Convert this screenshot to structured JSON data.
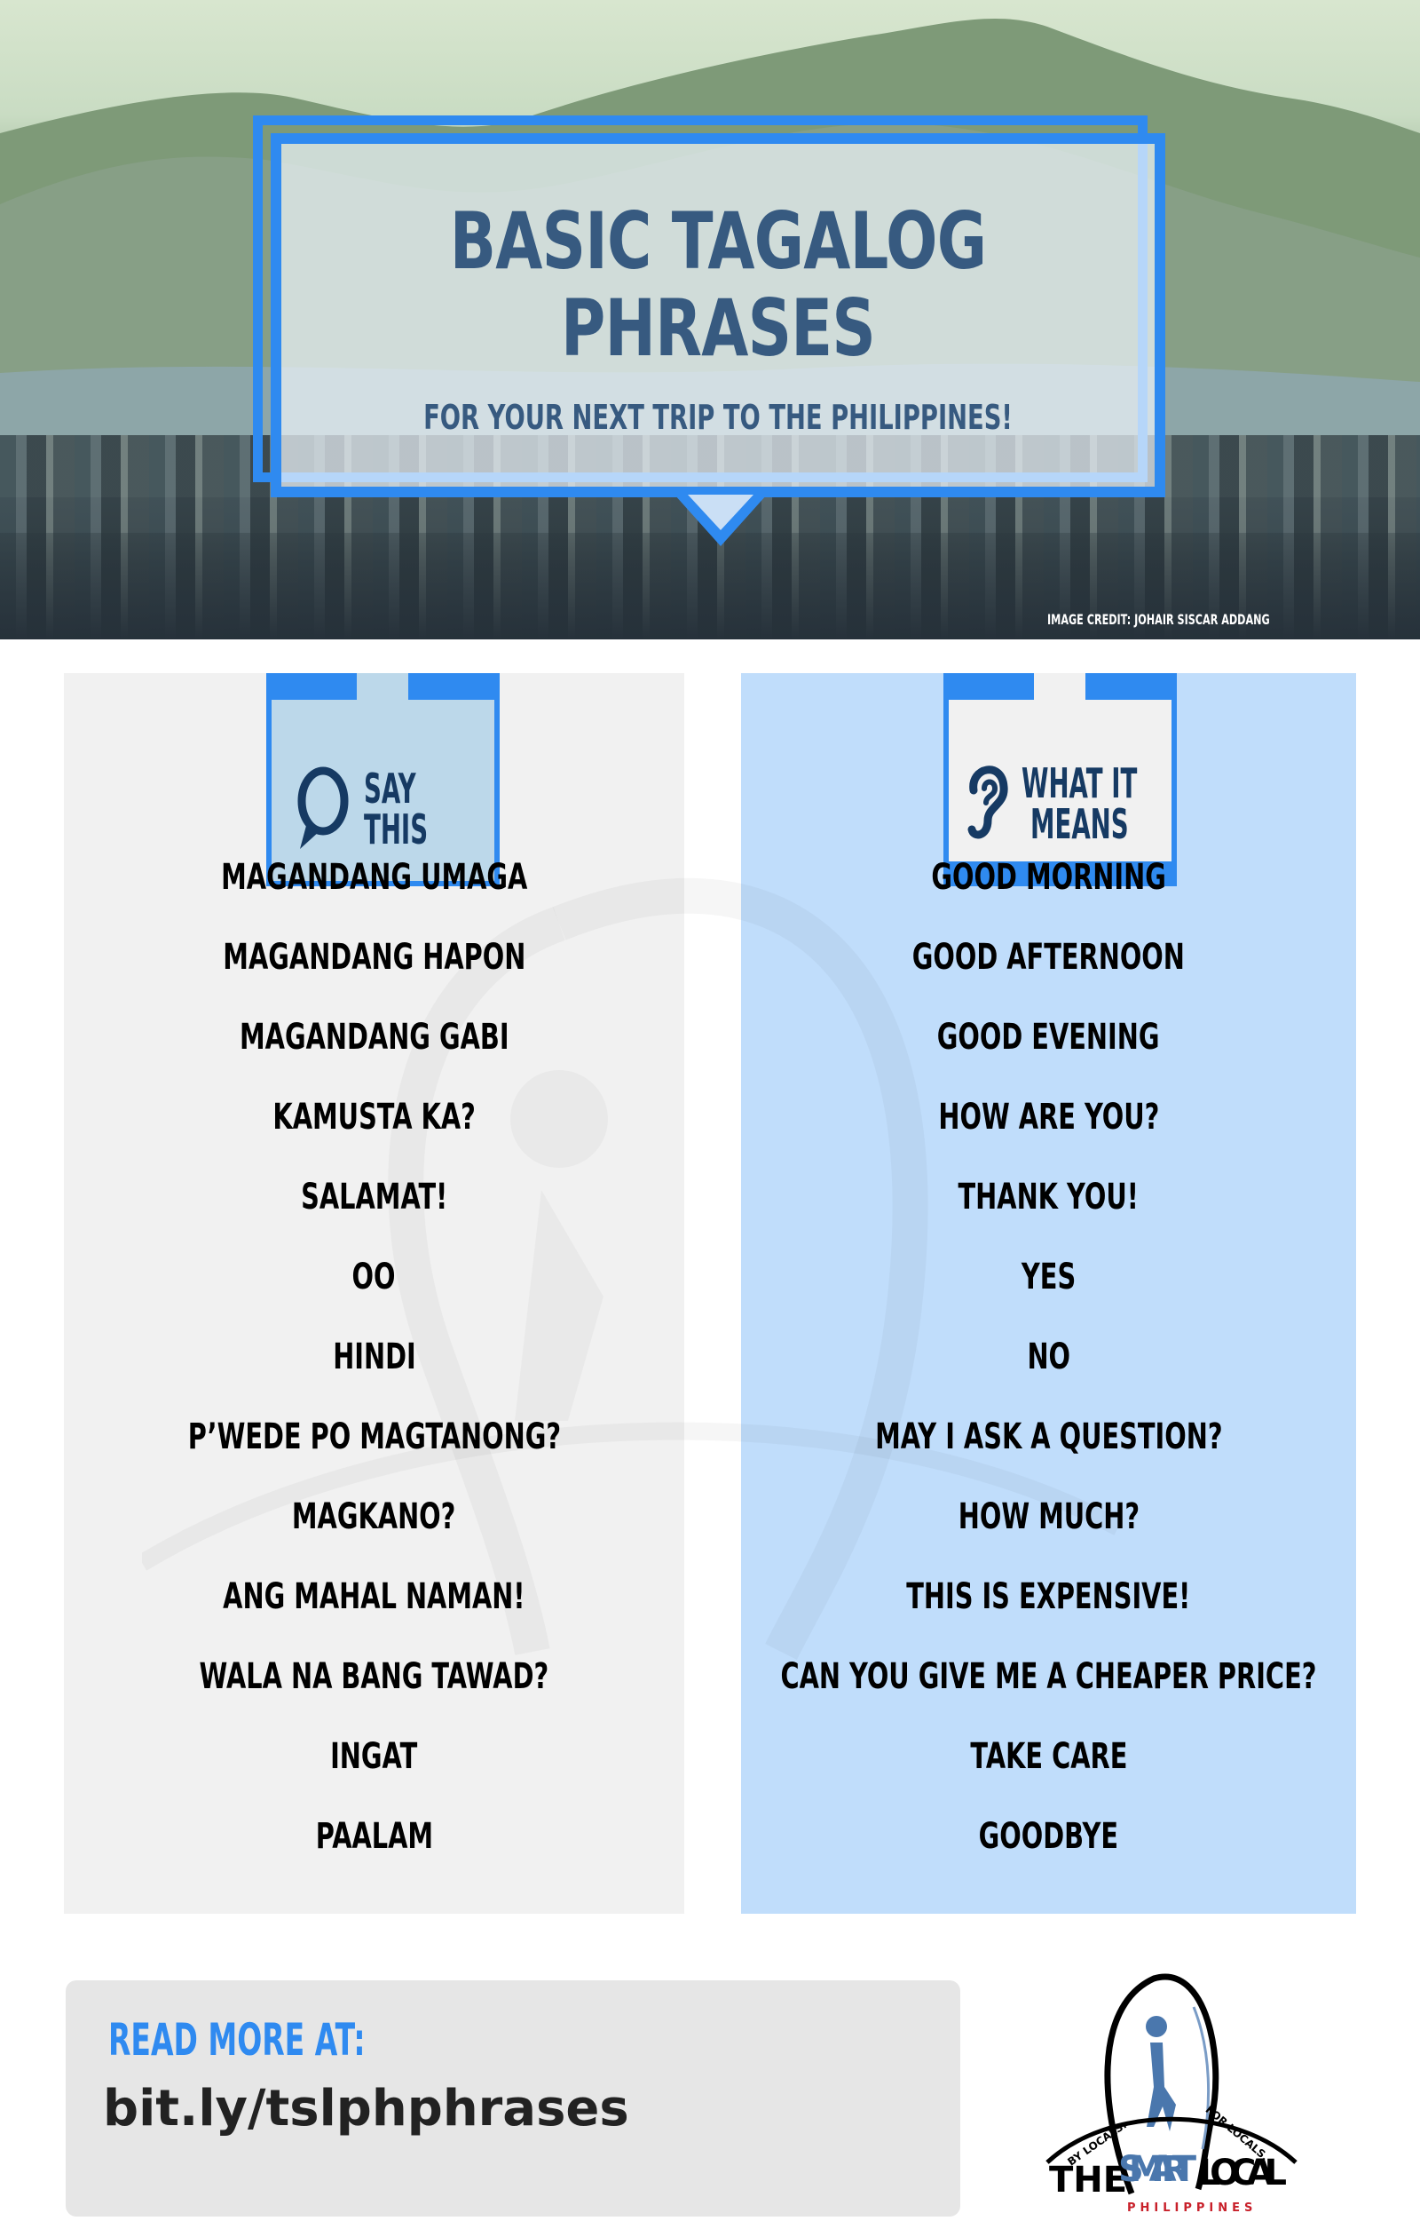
{
  "hero": {
    "title_line1": "BASIC TAGALOG",
    "title_line2": "PHRASES",
    "subtitle": "FOR YOUR NEXT TRIP TO THE PHILIPPINES!",
    "image_credit": "IMAGE CREDIT: JOHAIR SISCAR ADDANG"
  },
  "columns": {
    "left": {
      "header_line1": "SAY",
      "header_line2": "THIS",
      "icon": "speech-bubble-icon",
      "items": [
        "MAGANDANG UMAGA",
        "MAGANDANG HAPON",
        "MAGANDANG GABI",
        "KAMUSTA KA?",
        "SALAMAT!",
        "OO",
        "HINDI",
        "P’WEDE PO MAGTANONG?",
        "MAGKANO?",
        "ANG MAHAL NAMAN!",
        "WALA NA BANG TAWAD?",
        "INGAT",
        "PAALAM"
      ]
    },
    "right": {
      "header_line1": "WHAT IT",
      "header_line2": "MEANS",
      "icon": "ear-icon",
      "items": [
        "GOOD MORNING",
        "GOOD AFTERNOON",
        "GOOD EVENING",
        "HOW ARE YOU?",
        "THANK YOU!",
        "YES",
        "NO",
        "MAY I ASK A QUESTION?",
        "HOW MUCH?",
        "THIS IS EXPENSIVE!",
        "CAN YOU GIVE ME A CHEAPER PRICE?",
        "TAKE CARE",
        "GOODBYE"
      ]
    }
  },
  "footer": {
    "read_more_label": "READ MORE AT:",
    "link": "bit.ly/tslphphrases"
  },
  "logo": {
    "by_locals": "BY LOCALS.",
    "for_locals": "FOR LOCALS.",
    "the": "THE",
    "smart": "SMART",
    "local": "LOCAL",
    "country": "PHILIPPINES"
  },
  "colors": {
    "accent_blue": "#2f8af0",
    "title_navy": "#375a80",
    "left_panel_bg": "#f1f1f1",
    "right_panel_bg": "#c0ddfb",
    "logo_red": "#c8202a",
    "logo_blue": "#4a77ad"
  }
}
